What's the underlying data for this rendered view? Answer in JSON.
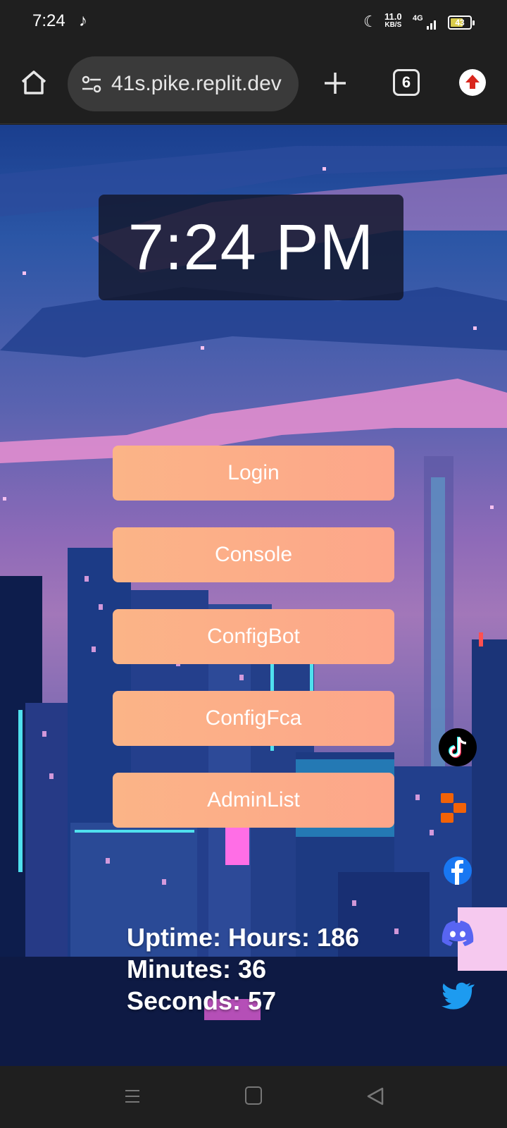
{
  "status_bar": {
    "time": "7:24",
    "net_speed_value": "11.0",
    "net_speed_unit": "KB/S",
    "network_type": "4G",
    "battery_level": "43",
    "icons": [
      "music-note-icon",
      "do-not-disturb-moon-icon",
      "signal-icon",
      "battery-icon"
    ]
  },
  "browser": {
    "url": "41s.pike.replit.dev",
    "tab_count": "6",
    "icons": [
      "home-icon",
      "site-settings-icon",
      "new-tab-icon",
      "tab-switcher-icon",
      "update-arrow-icon"
    ]
  },
  "page": {
    "clock_time": "7:24 PM",
    "buttons": [
      {
        "label": "Login"
      },
      {
        "label": "Console"
      },
      {
        "label": "ConfigBot"
      },
      {
        "label": "ConfigFca"
      },
      {
        "label": "AdminList"
      }
    ],
    "uptime": {
      "line1": "Uptime: Hours: 186",
      "line2": "Minutes: 36",
      "line3": "Seconds: 57"
    },
    "social_icons": [
      "tiktok-icon",
      "replit-icon",
      "facebook-icon",
      "discord-icon",
      "twitter-icon"
    ],
    "colors": {
      "button_start": "#fbb487",
      "button_end": "#fda68a",
      "clock_bg": "#12162a"
    }
  },
  "nav_bar": {
    "icons": [
      "recents-menu-icon",
      "home-square-icon",
      "back-triangle-icon"
    ]
  }
}
